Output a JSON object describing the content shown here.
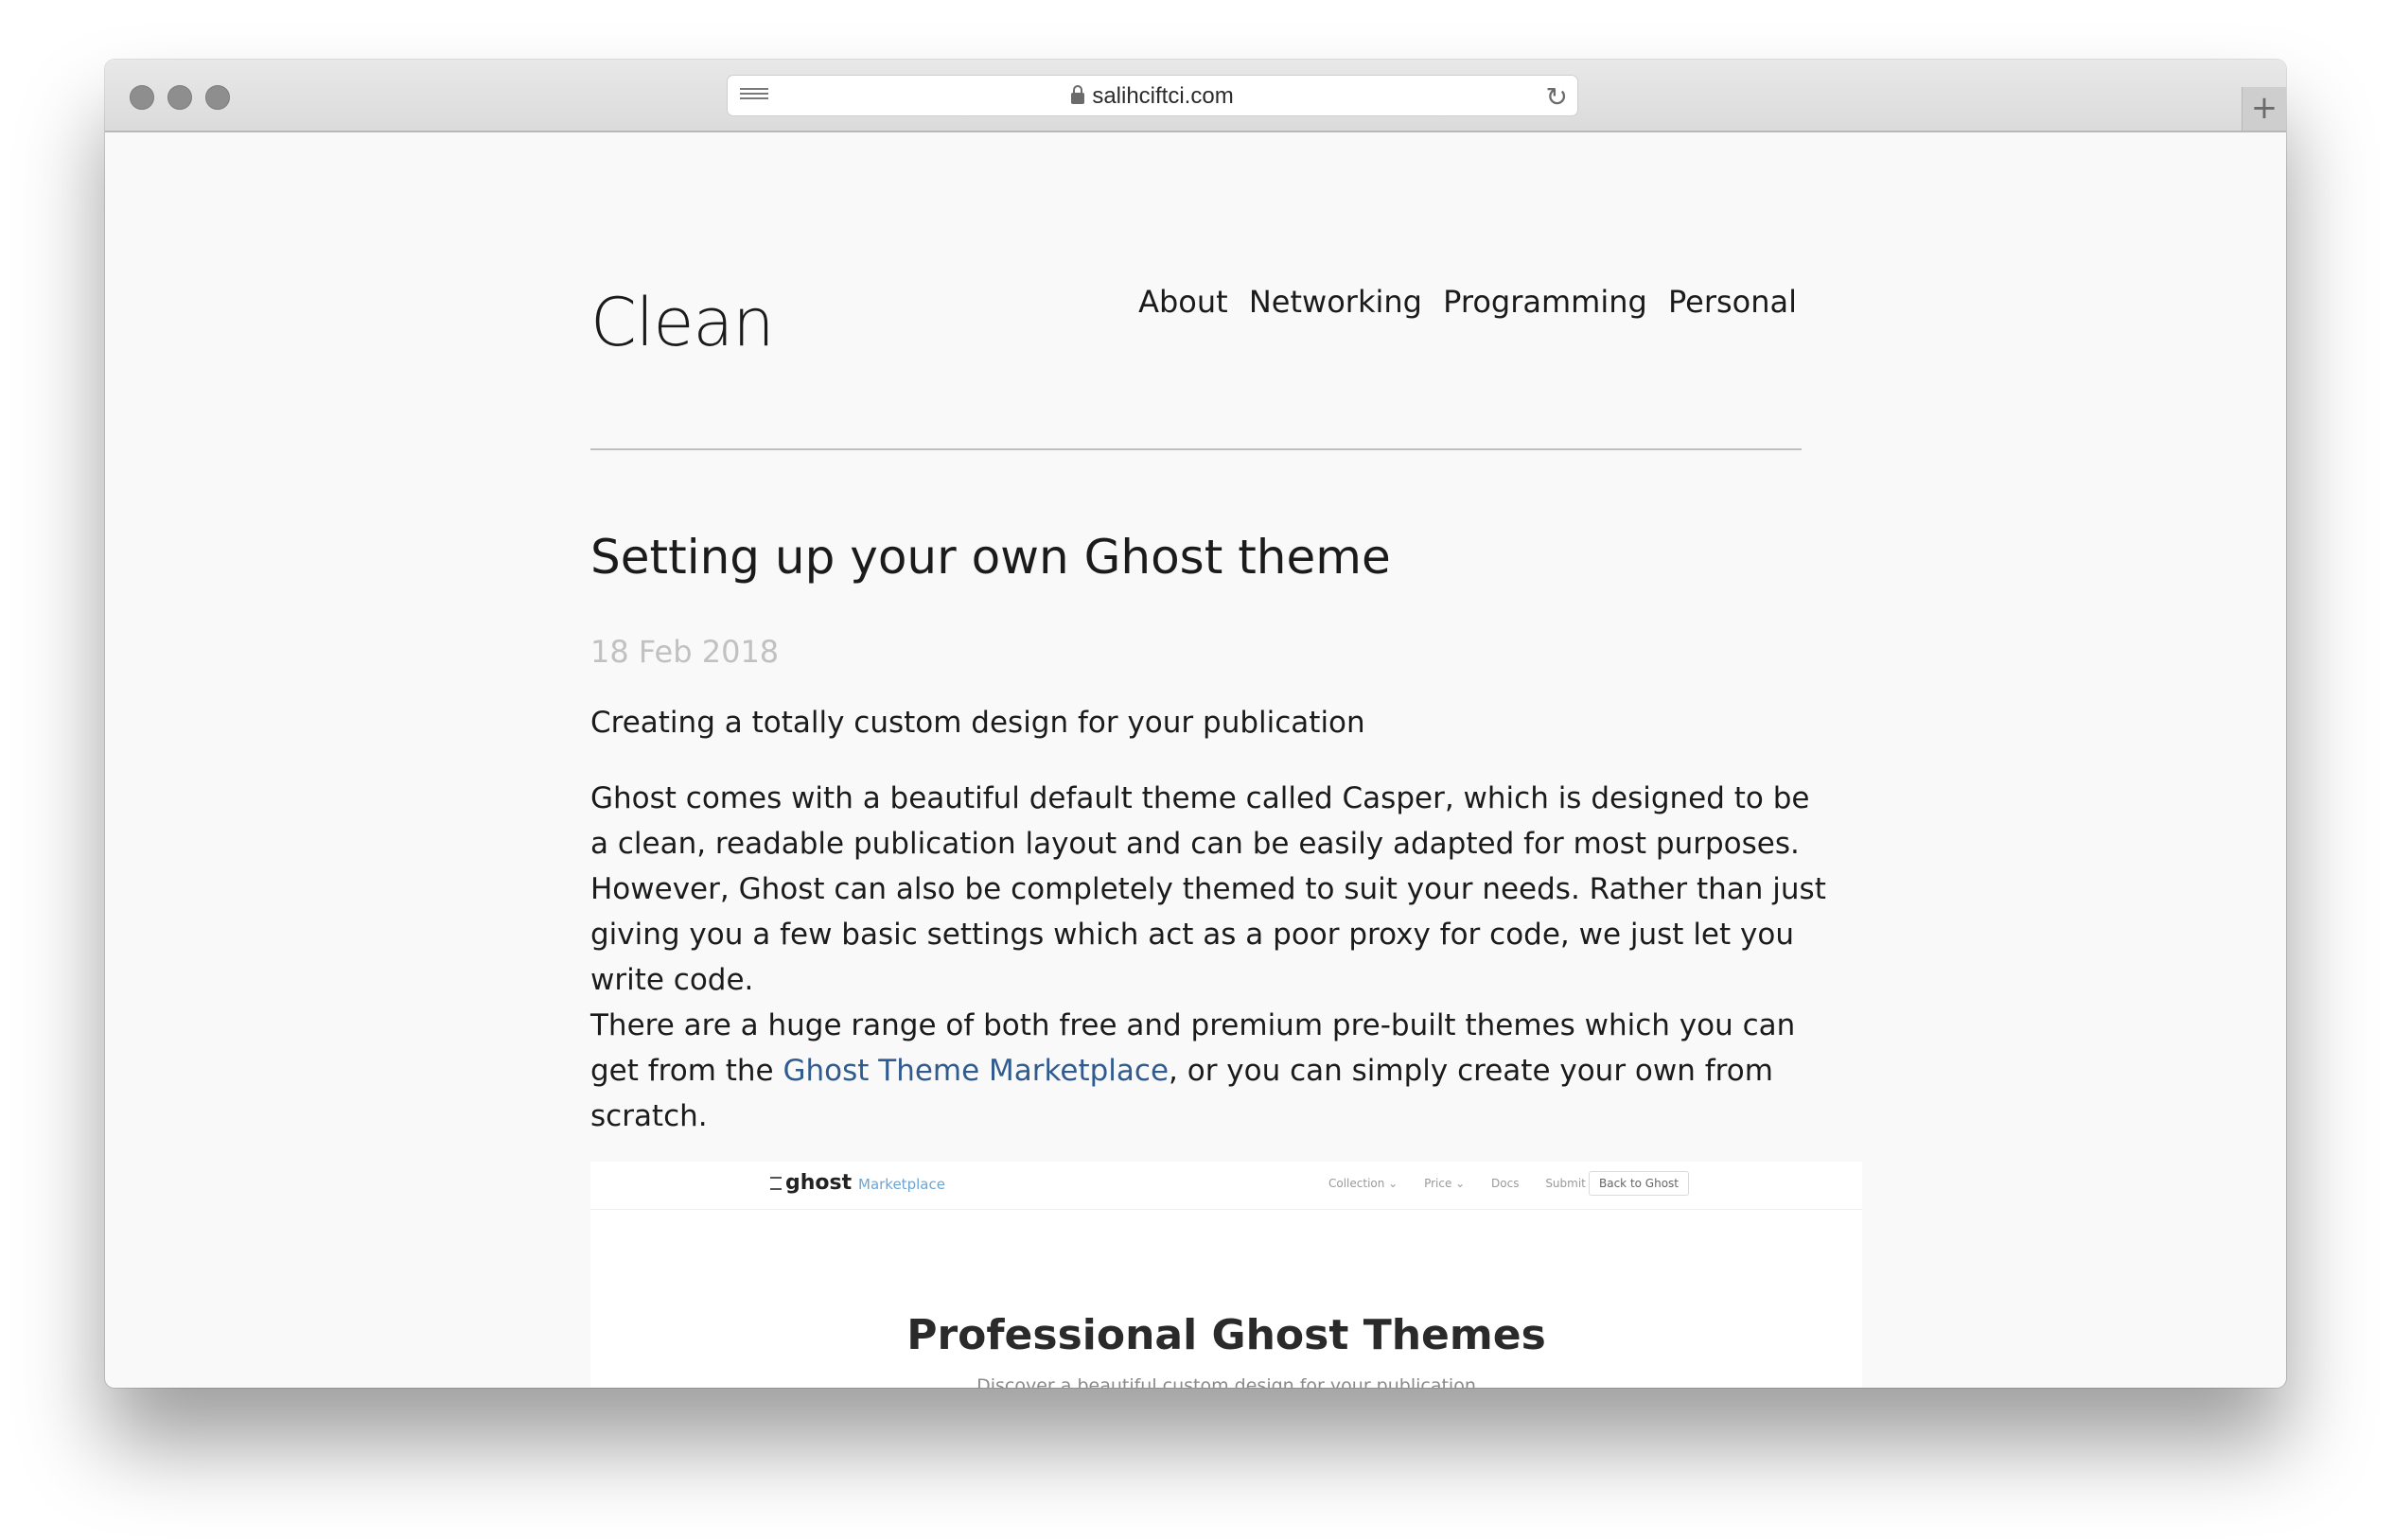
{
  "browser": {
    "url": "salihciftci.com",
    "new_tab_label": "+",
    "reload_glyph": "↻"
  },
  "site": {
    "title": "Clean",
    "nav": [
      "About",
      "Networking",
      "Programming",
      "Personal"
    ]
  },
  "post": {
    "title": "Setting up your own Ghost theme",
    "date": "18 Feb 2018",
    "lead": "Creating a totally custom design for your publication",
    "paragraph1": "Ghost comes with a beautiful default theme called Casper, which is designed to be a clean, readable publication layout and can be easily adapted for most purposes. However, Ghost can also be completely themed to suit your needs. Rather than just giving you a few basic settings which act as a poor proxy for code, we just let you write code.",
    "paragraph2_before": "There are a huge range of both free and premium pre-built themes which you can get from the ",
    "paragraph2_link": "Ghost Theme Marketplace",
    "paragraph2_after": ", or you can simply create your own from scratch."
  },
  "embed": {
    "logo": "ghost",
    "section": "Marketplace",
    "nav": [
      "Collection ⌄",
      "Price ⌄",
      "Docs",
      "Submit"
    ],
    "back_button": "Back to Ghost",
    "title": "Professional Ghost Themes",
    "subtitle": "Discover a beautiful custom design for your publication"
  },
  "colors": {
    "link": "#2f5b8e",
    "date": "#c1c1c1",
    "page_bg": "#f9f9f9"
  }
}
